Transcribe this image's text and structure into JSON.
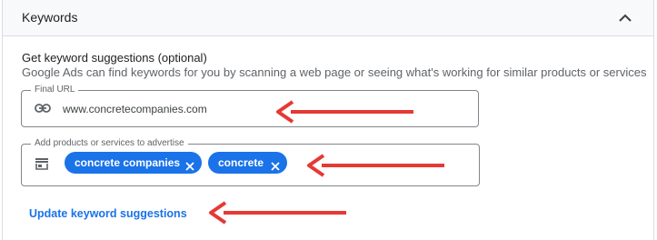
{
  "panel": {
    "title": "Keywords"
  },
  "suggestions": {
    "heading": "Get keyword suggestions (optional)",
    "description": "Google Ads can find keywords for you by scanning a web page or seeing what's working for similar products or services"
  },
  "final_url": {
    "label": "Final URL",
    "value": "www.concretecompanies.com",
    "icon": "link-icon"
  },
  "products": {
    "label": "Add products or services to advertise",
    "icon": "storefront-icon",
    "chips": [
      "concrete companies",
      "concrete"
    ]
  },
  "update_link": "Update keyword suggestions",
  "colors": {
    "accent": "#1a73e8",
    "annotation_arrow": "#e53935"
  }
}
